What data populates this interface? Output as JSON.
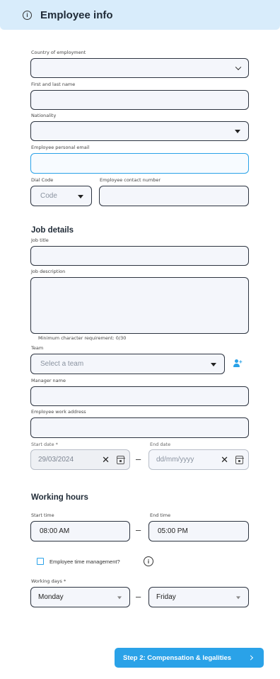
{
  "header": {
    "title": "Employee info",
    "icon": "info-icon"
  },
  "employee": {
    "country_label": "Country of employment",
    "country_value": "",
    "name_label": "First and last name",
    "name_value": "",
    "nationality_label": "Nationality",
    "nationality_value": "",
    "email_label": "Employee personal email",
    "email_value": "",
    "dial_code_label": "Dial Code",
    "dial_code_placeholder": "Code",
    "contact_label": "Employee contact number",
    "contact_value": ""
  },
  "job": {
    "section_title": "Job details",
    "title_label": "Job title",
    "title_value": "",
    "description_label": "Job description",
    "description_value": "",
    "description_hint": "Minimum character requirement: 0/30",
    "team_label": "Team",
    "team_placeholder": "Select a team",
    "manager_label": "Manager name",
    "manager_value": "",
    "address_label": "Employee work address",
    "address_value": "",
    "start_date_label": "Start date *",
    "start_date_value": "29/03/2024",
    "end_date_label": "End date",
    "end_date_placeholder": "dd/mm/yyyy",
    "range_separator": "–"
  },
  "hours": {
    "section_title": "Working hours",
    "start_time_label": "Start time",
    "start_time_value": "08:00 AM",
    "end_time_label": "End time",
    "end_time_value": "05:00 PM",
    "time_management_label": "Employee time management?",
    "time_management_checked": false,
    "working_days_label": "Working days *",
    "day_from": "Monday",
    "day_to": "Friday",
    "range_separator": "–"
  },
  "footer": {
    "next_button": "Step 2: Compensation & legalities"
  },
  "colors": {
    "accent": "#2aa2e8",
    "header_bg": "#d8ecfb",
    "field_bg": "#f4f6fb"
  }
}
